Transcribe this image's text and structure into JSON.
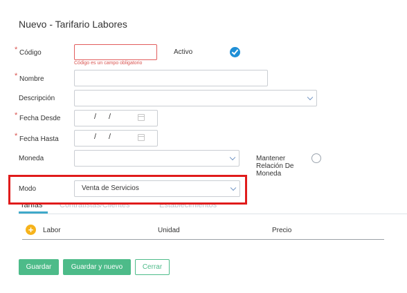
{
  "form": {
    "title": "Nuevo - Tarifario Labores",
    "required_mark": "*",
    "codigo": {
      "label": "Código",
      "value": "",
      "error": "Código es un campo obligatorio"
    },
    "activo": {
      "label": "Activo",
      "checked": true
    },
    "nombre": {
      "label": "Nombre",
      "value": ""
    },
    "descripcion": {
      "label": "Descripción",
      "value": ""
    },
    "fecha_desde": {
      "label": "Fecha Desde",
      "sep": "/"
    },
    "fecha_hasta": {
      "label": "Fecha Hasta",
      "sep": "/"
    },
    "moneda": {
      "label": "Moneda",
      "value": ""
    },
    "mantener": {
      "label_line1": "Mantener",
      "label_line2": "Relación De",
      "label_line3": "Moneda",
      "checked": false
    },
    "modo": {
      "label": "Modo",
      "value": "Venta de Servicios"
    }
  },
  "tabs": [
    {
      "label": "Tarifas",
      "active": true
    },
    {
      "label": "Contratistas/Clientes",
      "active": false
    },
    {
      "label": "Establecimientos",
      "active": false
    }
  ],
  "table": {
    "add_icon": "plus-icon",
    "columns": [
      "Labor",
      "Unidad",
      "Precio"
    ]
  },
  "buttons": {
    "save": "Guardar",
    "save_new": "Guardar y nuevo",
    "close": "Cerrar"
  },
  "colors": {
    "accent_green": "#4dbb89",
    "error_red": "#d9534f",
    "highlight_red": "#e01b1b",
    "check_blue": "#1f8fd6"
  }
}
